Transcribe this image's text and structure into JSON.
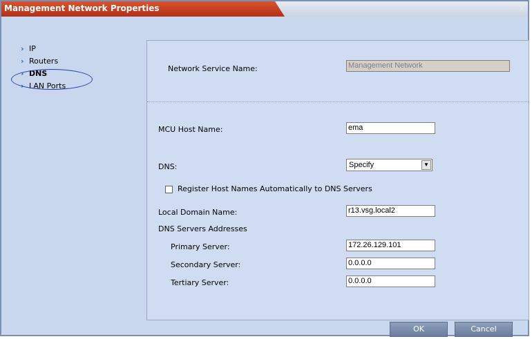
{
  "window": {
    "title": "Management Network Properties",
    "close_glyph": "×"
  },
  "nav": {
    "items": [
      {
        "label": "IP"
      },
      {
        "label": "Routers"
      },
      {
        "label": "DNS"
      },
      {
        "label": "LAN Ports"
      }
    ],
    "arrow_glyph": "›"
  },
  "form": {
    "service_name_label": "Network Service Name:",
    "service_name_value": "Management Network",
    "host_name_label": "MCU Host Name:",
    "host_name_value": "ema",
    "dns_label": "DNS:",
    "dns_value": "Specify",
    "register_label": "Register Host Names Automatically to DNS Servers",
    "domain_label": "Local Domain Name:",
    "domain_value": "r13.vsg.local2",
    "dns_servers_heading": "DNS Servers Addresses",
    "primary_label": "Primary Server:",
    "primary_value": "172.26.129.101",
    "secondary_label": "Secondary Server:",
    "secondary_value": "0.0.0.0",
    "tertiary_label": "Tertiary Server:",
    "tertiary_value": "0.0.0.0"
  },
  "buttons": {
    "ok": "OK",
    "cancel": "Cancel"
  }
}
